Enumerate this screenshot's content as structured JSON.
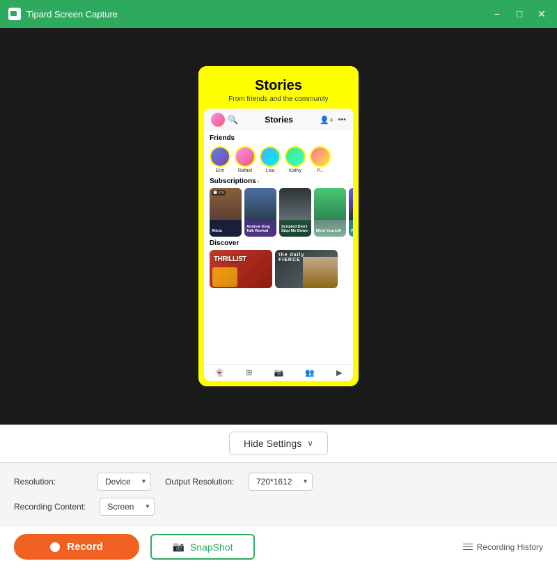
{
  "titleBar": {
    "title": "Tipard Screen Capture",
    "minimizeLabel": "−",
    "maximizeLabel": "□",
    "closeLabel": "✕"
  },
  "phone": {
    "storiesTitle": "Stories",
    "storiesSubtitle": "From friends and the community",
    "navTitle": "Stories",
    "friends": {
      "label": "Friends",
      "items": [
        {
          "name": "Erin"
        },
        {
          "name": "Rafael"
        },
        {
          "name": "Lisa"
        },
        {
          "name": "Kathy"
        },
        {
          "name": "P..."
        }
      ]
    },
    "subscriptions": {
      "label": "Subscriptions",
      "items": [
        {
          "name": "Alicia",
          "timer": "🕐 17s"
        },
        {
          "name": "Andrew King Talk Revival"
        },
        {
          "name": "Scripted Don't Stop Me Down"
        },
        {
          "name": "Mind Yourself"
        },
        {
          "name": "Who Is She"
        }
      ]
    },
    "discover": {
      "label": "Discover",
      "items": [
        {
          "name": "THRILLIST"
        },
        {
          "name": "fierce"
        }
      ]
    }
  },
  "settingsBar": {
    "hideSettingsLabel": "Hide Settings",
    "chevron": "∨"
  },
  "settings": {
    "resolutionLabel": "Resolution:",
    "resolutionValue": "Device",
    "outputResolutionLabel": "Output Resolution:",
    "outputResolutionValue": "720*1612",
    "recordingContentLabel": "Recording Content:",
    "recordingContentValue": "Screen"
  },
  "actionBar": {
    "recordLabel": "Record",
    "snapshotLabel": "SnapShot",
    "recordingHistoryLabel": "Recording History"
  }
}
